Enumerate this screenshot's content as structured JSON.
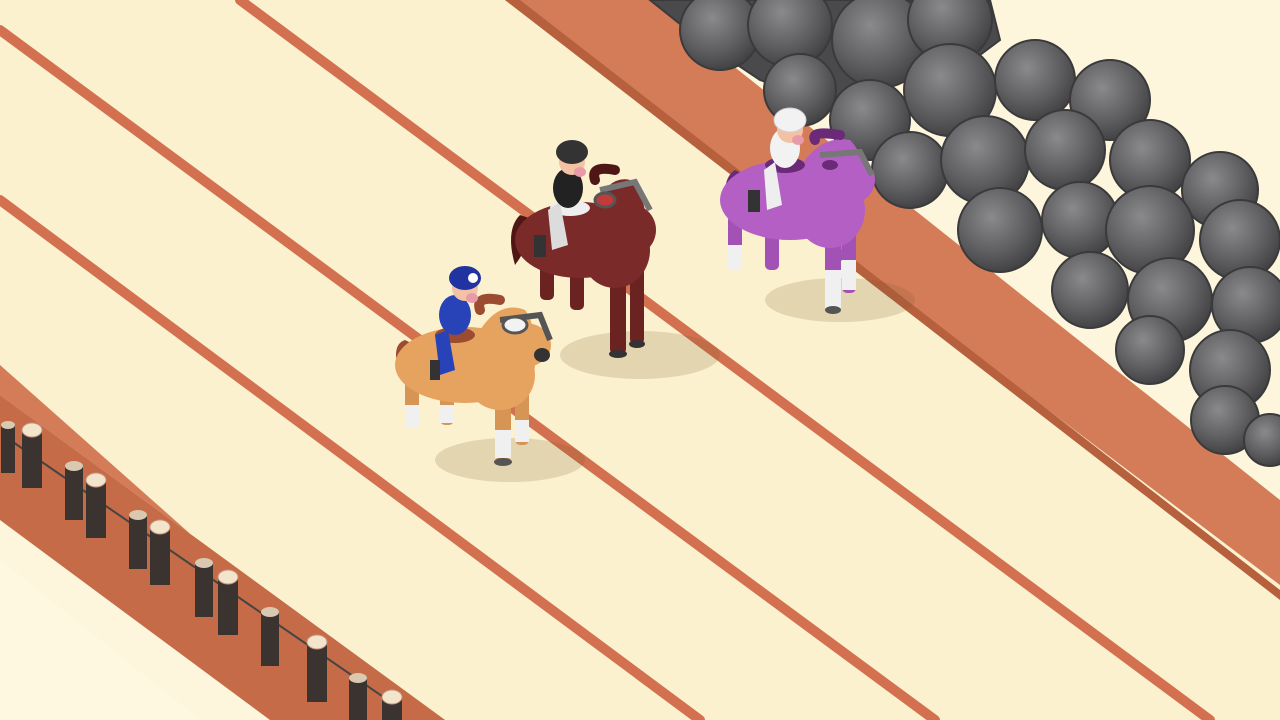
{
  "scene": {
    "type": "isometric horse race",
    "lanes": 3,
    "track_color": "#fbf1cf",
    "lane_line_color": "#d2704f",
    "wall_color": "#cf7a55",
    "rock_color": "#5d5d5f"
  },
  "racers": [
    {
      "lane": 1,
      "horse_color": "#e6a35f",
      "mane_color": "#9a4b30",
      "jockey_helmet": "#2033a0",
      "jockey_suit": "#2842b8"
    },
    {
      "lane": 2,
      "horse_color": "#7a2a28",
      "mane_color": "#4e1716",
      "jockey_helmet": "#333333",
      "jockey_suit": "#222222"
    },
    {
      "lane": 3,
      "horse_color": "#b45fc4",
      "mane_color": "#6a2a78",
      "jockey_helmet": "#f2f2f2",
      "jockey_suit": "#eeeeee"
    }
  ],
  "hud": {}
}
